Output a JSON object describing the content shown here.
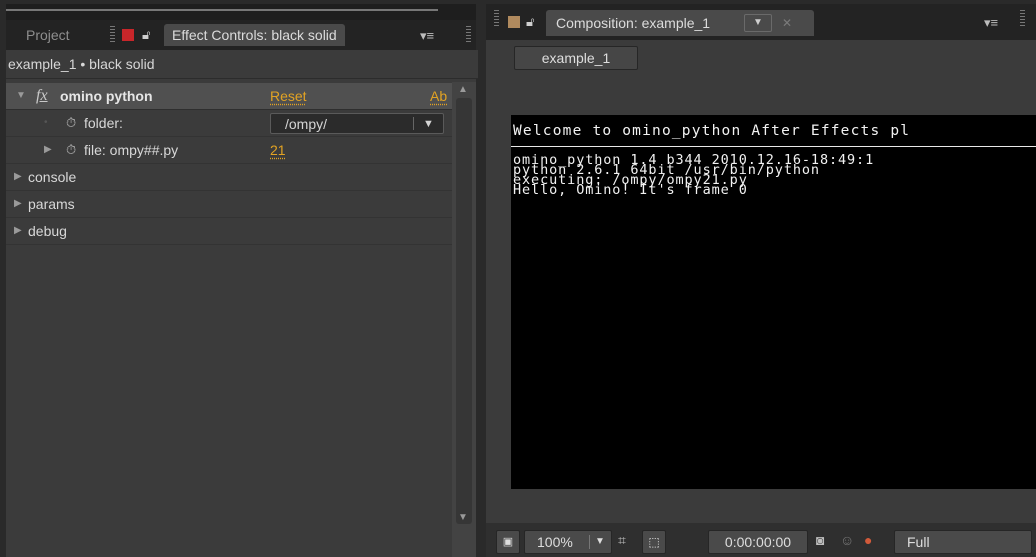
{
  "left_panel": {
    "tab_project": "Project",
    "tab_effect_controls": "Effect Controls: black solid",
    "breadcrumb": "example_1 • black solid",
    "effect": {
      "fx_icon": "fx",
      "name": "omino python",
      "reset": "Reset",
      "about": "Ab"
    },
    "properties": [
      {
        "label": "folder:",
        "value": "/ompy/"
      },
      {
        "label": "file: ompy##.py",
        "value": "21"
      },
      {
        "label": "console"
      },
      {
        "label": "params"
      },
      {
        "label": "debug"
      }
    ]
  },
  "right_panel": {
    "tab_title": "Composition: example_1",
    "composition_tab": "example_1",
    "canvas": {
      "title": "Welcome to omino_python After Effects pl",
      "lines": [
        "omino_python 1.4 b344 2010.12.16-18:49:1",
        "python 2.6.1 64bit /usr/bin/python",
        "executing: /ompy/ompy21.py",
        "Hello, Omino! It's frame 0"
      ]
    },
    "toolbar": {
      "zoom": "100%",
      "timecode": "0:00:00:00",
      "resolution": "Full"
    }
  },
  "colors": {
    "accent_gold": "#e2a323",
    "label_red": "#c8262a",
    "label_tan": "#b08a5e",
    "canvas_bg": "#000000"
  },
  "icons": [
    "lock-icon",
    "panel-menu-icon",
    "stopwatch-icon",
    "camera-icon",
    "channels-icon",
    "region-of-interest-icon",
    "grid-icon"
  ]
}
